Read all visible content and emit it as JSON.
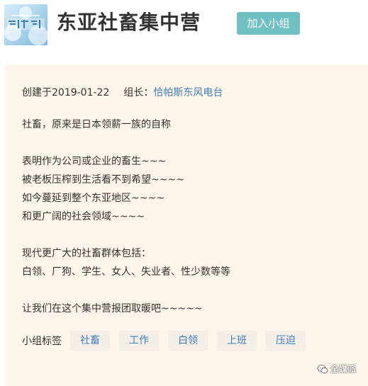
{
  "group": {
    "title": "东亚社畜集中营",
    "join_label": "加入小组"
  },
  "meta": {
    "created_text": "创建于2019-01-22",
    "leader_label": "组长：",
    "leader_name": "恰帕斯东风电台"
  },
  "intro": {
    "lines": [
      "社畜，原来是日本领薪一族的自称",
      "",
      "表明作为公司或企业的畜生~~~",
      "被老板压榨到生活看不到希望~~~~",
      "如今蔓延到整个东亚地区~~~~",
      "和更广阔的社会领域~~~~",
      "",
      "现代更广大的社畜群体包括：",
      "白领、厂狗、学生、女人、失业者、性少数等等",
      "",
      "让我们在这个集中营报团取暖吧~~~~~"
    ]
  },
  "tags": {
    "label": "小组标签",
    "items": [
      "社畜",
      "工作",
      "白领",
      "上班",
      "压迫"
    ]
  },
  "watermark": {
    "text": "全媒派"
  },
  "colors": {
    "accent": "#6fbfc3",
    "link": "#3d7fb6",
    "card_bg": "#fdf4ea",
    "tag_bg": "#f3eee8"
  }
}
